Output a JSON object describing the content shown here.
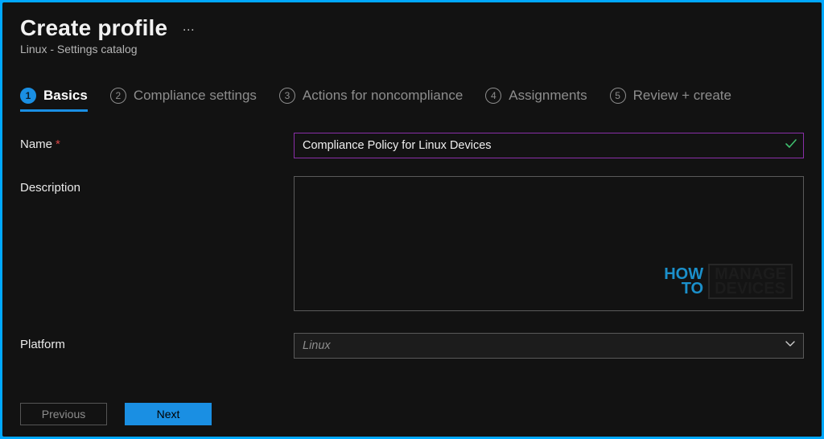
{
  "header": {
    "title": "Create profile",
    "more": "…",
    "subtitle": "Linux - Settings catalog"
  },
  "tabs": [
    {
      "num": "1",
      "label": "Basics"
    },
    {
      "num": "2",
      "label": "Compliance settings"
    },
    {
      "num": "3",
      "label": "Actions for noncompliance"
    },
    {
      "num": "4",
      "label": "Assignments"
    },
    {
      "num": "5",
      "label": "Review + create"
    }
  ],
  "form": {
    "name_label": "Name",
    "name_value": "Compliance Policy for Linux Devices",
    "description_label": "Description",
    "description_value": "",
    "platform_label": "Platform",
    "platform_value": "Linux"
  },
  "buttons": {
    "previous": "Previous",
    "next": "Next"
  },
  "watermark": {
    "how": "HOW",
    "to": "TO",
    "manage": "MANAGE",
    "devices": "DEVICES"
  }
}
